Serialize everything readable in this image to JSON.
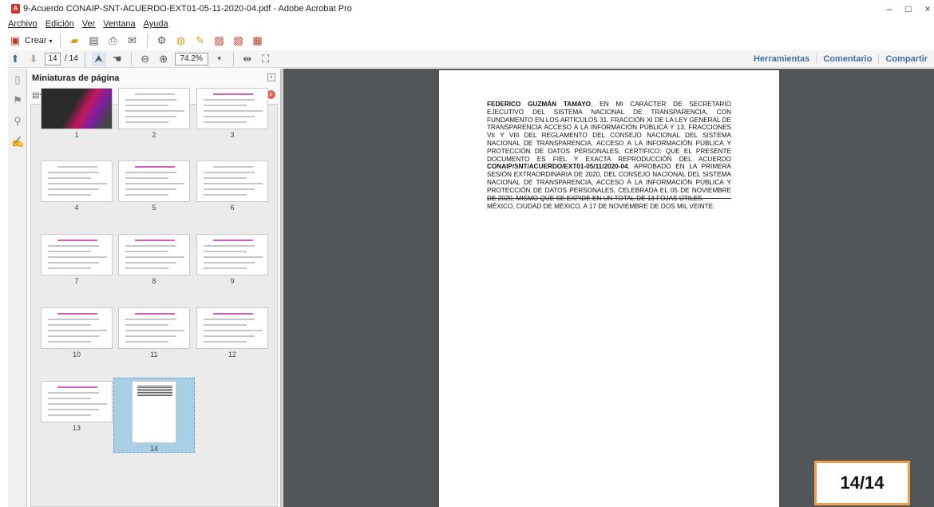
{
  "window": {
    "title": "9-Acuerdo CONAIP-SNT-ACUERDO-EXT01-05-11-2020-04.pdf - Adobe Acrobat Pro",
    "app_icon": "pdf-app-icon",
    "minimize": "–",
    "maximize": "□",
    "close": "×"
  },
  "menu": [
    "Archivo",
    "Edición",
    "Ver",
    "Ventana",
    "Ayuda"
  ],
  "toolbar": {
    "create_label": "Crear",
    "icons": [
      "open-folder-icon",
      "save-icon",
      "print-icon",
      "email-icon",
      "settings-icon",
      "comment-icon",
      "highlight-icon",
      "pdf-export-icon",
      "pdf-create-icon",
      "pdf-share-icon"
    ]
  },
  "navbar": {
    "current_page": "14",
    "total_pages": "/ 14",
    "zoom": "74.2%",
    "tools_label": "Herramientas",
    "comment_label": "Comentario",
    "share_label": "Compartir"
  },
  "thumbnails_panel": {
    "title": "Miniaturas de página",
    "pages": [
      "1",
      "2",
      "3",
      "4",
      "5",
      "6",
      "7",
      "8",
      "9",
      "10",
      "11",
      "12",
      "13",
      "14"
    ],
    "selected_page": "14"
  },
  "document": {
    "name_bold": "FEDERICO GUZMÁN TAMAYO",
    "para1": ", EN MI CARÁCTER DE SECRETARIO EJECUTIVO DEL SISTEMA NACIONAL DE TRANSPARENCIA, CON FUNDAMENTO EN LOS ARTÍCULOS 31, FRACCIÓN XI DE LA LEY GENERAL DE TRANSPARENCIA ACCESO A LA INFORMACIÓN PÚBLICA Y 13, FRACCIONES VII Y VIII DEL REGLAMENTO DEL CONSEJO NACIONAL DEL SISTEMA NACIONAL DE TRANSPARENCIA, ACCESO A LA INFORMACIÓN PÚBLICA Y PROTECCIÓN DE DATOS PERSONALES; CERTIFICO: QUE EL PRESENTE DOCUMENTO ES FIEL Y EXACTA REPRODUCCIÓN DEL ACUERDO ",
    "agreement_bold": "CONAIP/SNT/ACUERDO/EXT01-05/11/2020-04",
    "para2": ", APROBADO EN LA PRIMERA SESIÓN EXTRAORDINARIA DE 2020, DEL CONSEJO NACIONAL DEL SISTEMA NACIONAL DE TRANSPARENCIA, ACCESO A LA INFORMACIÓN PÚBLICA Y PROTECCIÓN DE DATOS PERSONALES, CELEBRADA EL 05 DE NOVIEMBRE DE 2020, MISMO QUE SE EXPIDE EN UN TOTAL DE 13 FOJAS ÚTILES.",
    "place_date": "MÉXICO, CIUDAD DE MÉXICO, A 17 DE NOVIEMBRE DE DOS MIL VEINTE."
  },
  "page_badge": "14/14"
}
